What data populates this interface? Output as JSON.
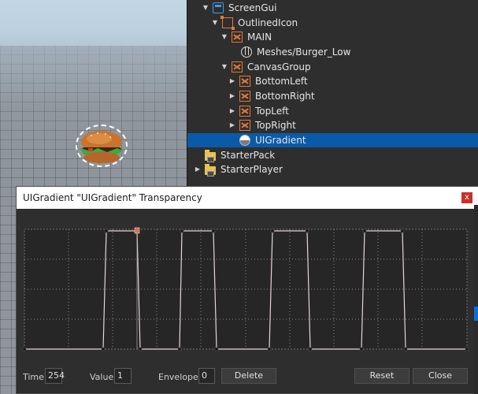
{
  "explorer": {
    "items": [
      {
        "label": "ScreenGui",
        "icon": "screengui-icon",
        "expanded": true
      },
      {
        "label": "OutlinedIcon",
        "icon": "outline-frame-icon",
        "expanded": true
      },
      {
        "label": "MAIN",
        "icon": "image-label-icon",
        "expanded": true
      },
      {
        "label": "Meshes/Burger_Low",
        "icon": "mesh-globe-icon"
      },
      {
        "label": "CanvasGroup",
        "icon": "canvas-group-icon",
        "expanded": true
      },
      {
        "label": "BottomLeft",
        "icon": "image-label-icon",
        "expanded": false
      },
      {
        "label": "BottomRight",
        "icon": "image-label-icon",
        "expanded": false
      },
      {
        "label": "TopLeft",
        "icon": "image-label-icon",
        "expanded": false
      },
      {
        "label": "TopRight",
        "icon": "image-label-icon",
        "expanded": false
      },
      {
        "label": "UIGradient",
        "icon": "gradient-icon",
        "selected": true
      },
      {
        "label": "StarterPack",
        "icon": "folder-icon"
      },
      {
        "label": "StarterPlayer",
        "icon": "folder-icon",
        "expanded": false
      }
    ]
  },
  "dialog": {
    "title": "UIGradient \"UIGradient\" Transparency",
    "close_glyph": "x",
    "time_label": "Time",
    "time_value": "254",
    "value_label": "Value",
    "value_value": "1",
    "envelope_label": "Envelope",
    "envelope_value": "0",
    "delete_label": "Delete",
    "reset_label": "Reset",
    "close_label": "Close"
  },
  "colors": {
    "selection": "#0b5aa8",
    "keypoint_selected": "#e0603a",
    "line": "#e8d4d4"
  }
}
